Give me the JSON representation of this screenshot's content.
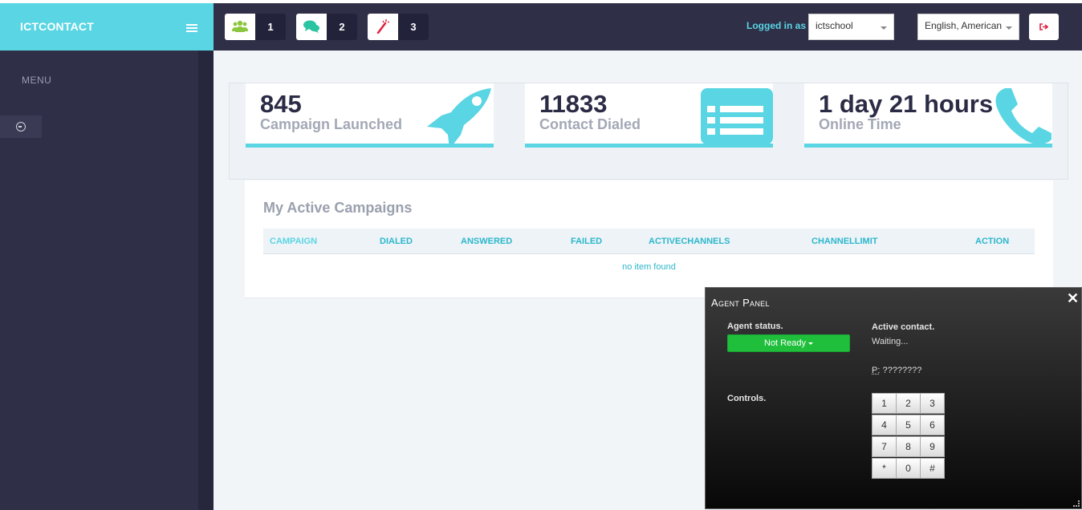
{
  "brand": {
    "name": "ICTCONTACT"
  },
  "sidebar": {
    "menu_label": "MENU"
  },
  "header": {
    "notifications": [
      {
        "icon": "users-icon",
        "count": "1",
        "color": "#8cc63f"
      },
      {
        "icon": "chat-icon",
        "count": "2",
        "color": "#2bc4a2"
      },
      {
        "icon": "magic-wand-icon",
        "count": "3",
        "color": "#e0213f"
      }
    ],
    "logged_in_label": "Logged in as :",
    "user": "ictschool",
    "language": "English, American"
  },
  "stats": [
    {
      "value": "845",
      "label": "Campaign Launched",
      "icon": "rocket-icon"
    },
    {
      "value": "11833",
      "label": "Contact Dialed",
      "icon": "list-icon"
    },
    {
      "value": "1 day 21 hours",
      "label": "Online Time",
      "icon": "phone-icon"
    }
  ],
  "campaigns": {
    "title": "My Active Campaigns",
    "columns": [
      "CAMPAIGN",
      "DIALED",
      "ANSWERED",
      "FAILED",
      "ACTIVECHANNELS",
      "CHANNELLIMIT",
      "ACTION"
    ],
    "empty_text": "no item found"
  },
  "agent_panel": {
    "title": "Agent Panel",
    "status_label": "Agent status.",
    "status_value": "Not Ready",
    "active_contact_label": "Active contact.",
    "active_contact_value": "Waiting...",
    "phone_prefix": "P:",
    "phone_value": "????????",
    "controls_label": "Controls.",
    "keypad": [
      "1",
      "2",
      "3",
      "4",
      "5",
      "6",
      "7",
      "8",
      "9",
      "*",
      "0",
      "#"
    ]
  },
  "colors": {
    "accent": "#5ad5e3",
    "sidebar": "#2f2f48",
    "status_green": "#1fbf3c"
  }
}
